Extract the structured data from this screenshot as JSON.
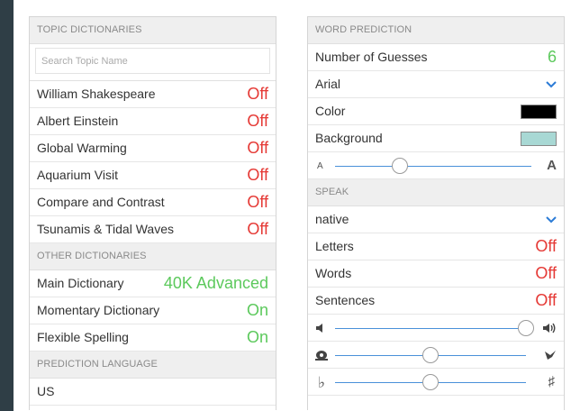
{
  "topic_dictionaries": {
    "header": "TOPIC DICTIONARIES",
    "search_placeholder": "Search Topic Name",
    "items": [
      {
        "label": "William Shakespeare",
        "state": "Off"
      },
      {
        "label": "Albert Einstein",
        "state": "Off"
      },
      {
        "label": "Global Warming",
        "state": "Off"
      },
      {
        "label": "Aquarium Visit",
        "state": "Off"
      },
      {
        "label": "Compare and Contrast",
        "state": "Off"
      },
      {
        "label": "Tsunamis & Tidal Waves",
        "state": "Off"
      }
    ]
  },
  "other_dictionaries": {
    "header": "OTHER DICTIONARIES",
    "items": [
      {
        "label": "Main Dictionary",
        "state": "40K Advanced"
      },
      {
        "label": "Momentary Dictionary",
        "state": "On"
      },
      {
        "label": "Flexible Spelling",
        "state": "On"
      }
    ]
  },
  "prediction_language": {
    "header": "PREDICTION LANGUAGE",
    "value": "US"
  },
  "word_prediction": {
    "header": "WORD PREDICTION",
    "guesses_label": "Number of Guesses",
    "guesses_value": "6",
    "font": "Arial",
    "color_label": "Color",
    "color_value": "#000000",
    "background_label": "Background",
    "background_value": "#a8d8d4",
    "font_size_small": "A",
    "font_size_large": "A",
    "font_size_level": 0.33
  },
  "speak": {
    "header": "SPEAK",
    "voice": "native",
    "items": [
      {
        "label": "Letters",
        "state": "Off"
      },
      {
        "label": "Words",
        "state": "Off"
      },
      {
        "label": "Sentences",
        "state": "Off"
      }
    ],
    "volume_level": 1.0,
    "speed_level": 0.5,
    "pitch_level": 0.5,
    "pitch_low_symbol": "♭",
    "pitch_high_symbol": "♯"
  },
  "colors": {
    "off": "#e53935",
    "on": "#5cc95c",
    "accent": "#4a90d9"
  }
}
